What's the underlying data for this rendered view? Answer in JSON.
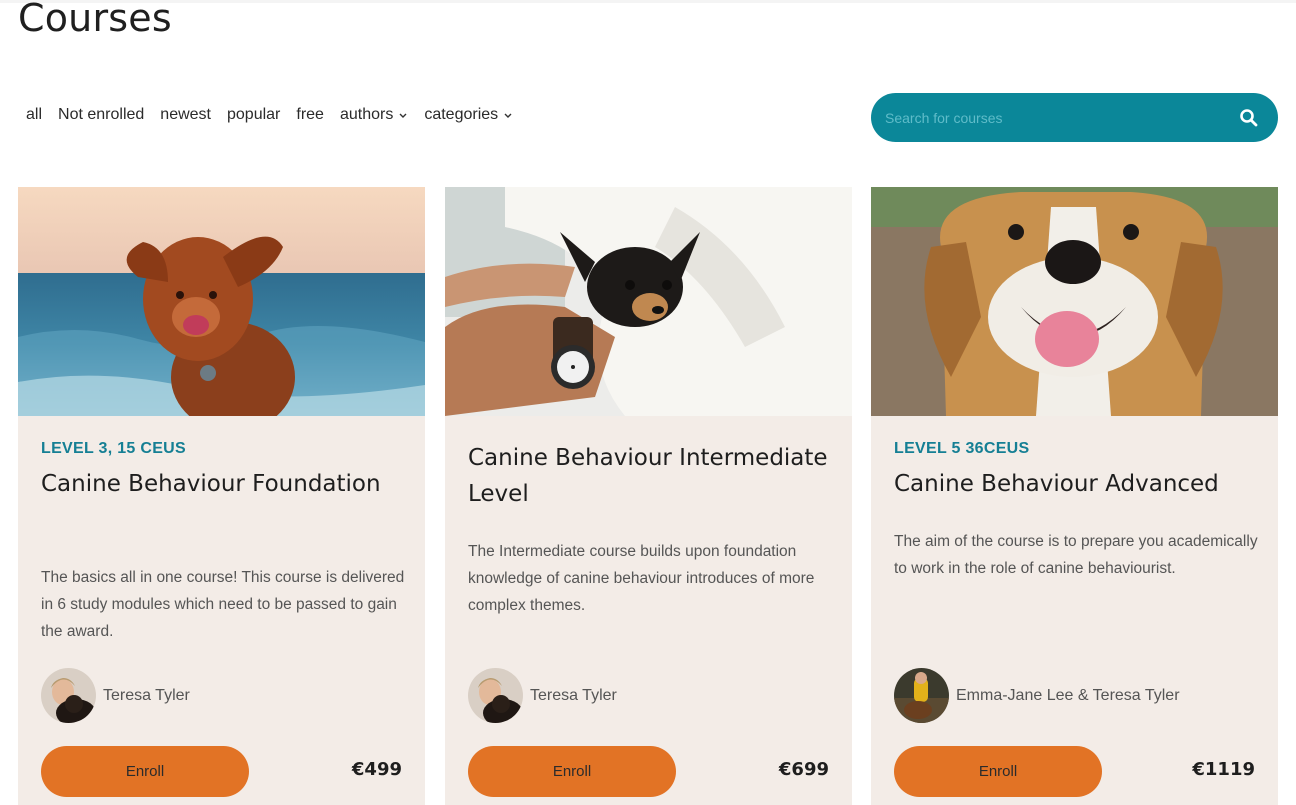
{
  "page": {
    "title": "Courses"
  },
  "filters": [
    {
      "label": "all",
      "dropdown": false
    },
    {
      "label": "Not enrolled",
      "dropdown": false
    },
    {
      "label": "newest",
      "dropdown": false
    },
    {
      "label": "popular",
      "dropdown": false
    },
    {
      "label": "free",
      "dropdown": false
    },
    {
      "label": "authors",
      "dropdown": true
    },
    {
      "label": "categories",
      "dropdown": true
    }
  ],
  "search": {
    "placeholder": "Search for courses",
    "value": "",
    "icon": "search-icon"
  },
  "colors": {
    "accent": "#0b8799",
    "enroll": "#e27325",
    "card_bg": "#f3ece7",
    "level": "#157f94"
  },
  "courses": [
    {
      "level": "LEVEL 3, 15 CEUS",
      "title": "Canine Behaviour Foundation",
      "description": "The basics all in one course! This course is delivered in 6 study modules which need to be passed to gain the award.",
      "author": "Teresa Tyler",
      "enroll_label": "Enroll",
      "price": "€499"
    },
    {
      "level": "",
      "title": "Canine Behaviour Intermediate Level",
      "description": "The Intermediate course builds upon foundation knowledge of canine behaviour introduces of more complex themes.",
      "author": "Teresa Tyler",
      "enroll_label": "Enroll",
      "price": "€699"
    },
    {
      "level": "LEVEL 5 36CEUS",
      "title": "Canine Behaviour Advanced",
      "description": "The aim of the course is to prepare you academically to work in the role of canine behaviourist.",
      "author": "Emma-Jane Lee & Teresa Tyler",
      "enroll_label": "Enroll",
      "price": "€1119"
    }
  ]
}
